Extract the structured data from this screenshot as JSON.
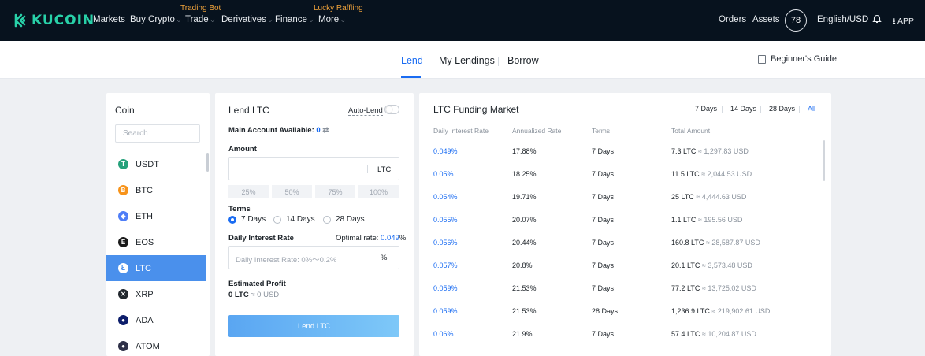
{
  "brand": {
    "name": "KUCOIN",
    "color": "#28d0a8"
  },
  "nav": {
    "items": [
      {
        "label": "Markets",
        "chevron": false
      },
      {
        "label": "Buy Crypto",
        "chevron": true
      },
      {
        "label": "Trade",
        "chevron": true,
        "tag": "Trading Bot"
      },
      {
        "label": "Derivatives",
        "chevron": true
      },
      {
        "label": "Finance",
        "chevron": true
      },
      {
        "label": "More",
        "chevron": true,
        "tag": "Lucky Raffling"
      }
    ],
    "orders": "Orders",
    "assets": "Assets",
    "avatar": "78",
    "language": "English/USD",
    "app": "APP"
  },
  "subnav": {
    "tabs": [
      {
        "label": "Lend",
        "active": true
      },
      {
        "label": "My Lendings",
        "active": false
      },
      {
        "label": "Borrow",
        "active": false
      }
    ],
    "guide": "Beginner's Guide"
  },
  "coin_panel": {
    "header": "Coin",
    "search_placeholder": "Search",
    "coins": [
      {
        "symbol": "USDT",
        "color": "#26a17b",
        "glyph": "T"
      },
      {
        "symbol": "BTC",
        "color": "#f7931a",
        "glyph": "B"
      },
      {
        "symbol": "ETH",
        "color": "#4f7ef7",
        "glyph": "◆"
      },
      {
        "symbol": "EOS",
        "color": "#1b1b1b",
        "glyph": "E"
      },
      {
        "symbol": "LTC",
        "color": "#ffffff",
        "glyph": "Ł",
        "active": true
      },
      {
        "symbol": "XRP",
        "color": "#23292f",
        "glyph": "✕"
      },
      {
        "symbol": "ADA",
        "color": "#0d1e6b",
        "glyph": "●"
      },
      {
        "symbol": "ATOM",
        "color": "#2e3148",
        "glyph": "●"
      }
    ]
  },
  "lend_panel": {
    "title": "Lend LTC",
    "autolend": "Auto-Lend",
    "account_label": "Main Account Available:",
    "account_value": "0",
    "amount_label": "Amount",
    "amount_unit": "LTC",
    "percents": [
      "25%",
      "50%",
      "75%",
      "100%"
    ],
    "terms_label": "Terms",
    "terms": [
      {
        "label": "7 Days",
        "selected": true
      },
      {
        "label": "14 Days",
        "selected": false
      },
      {
        "label": "28 Days",
        "selected": false
      }
    ],
    "rate_label": "Daily Interest Rate",
    "optimal_label": "Optimal rate:",
    "optimal_value": "0.049",
    "optimal_unit": "%",
    "rate_placeholder": "Daily Interest Rate: 0%～0.2%",
    "rate_unit": "%",
    "profit_label": "Estimated Profit",
    "profit_value": "0 LTC",
    "profit_usd": "≈ 0 USD",
    "button": "Lend LTC"
  },
  "market": {
    "title": "LTC Funding Market",
    "term_tabs": [
      {
        "label": "7 Days",
        "active": false
      },
      {
        "label": "14 Days",
        "active": false
      },
      {
        "label": "28 Days",
        "active": false
      },
      {
        "label": "All",
        "active": true
      }
    ],
    "columns": [
      "Daily Interest Rate",
      "Annualized Rate",
      "Terms",
      "Total Amount"
    ],
    "rows": [
      {
        "rate": "0.049%",
        "annual": "17.88%",
        "term": "7 Days",
        "amount": "7.3 LTC",
        "usd": "≈ 1,297.83 USD"
      },
      {
        "rate": "0.05%",
        "annual": "18.25%",
        "term": "7 Days",
        "amount": "11.5 LTC",
        "usd": "≈ 2,044.53 USD"
      },
      {
        "rate": "0.054%",
        "annual": "19.71%",
        "term": "7 Days",
        "amount": "25 LTC",
        "usd": "≈ 4,444.63 USD"
      },
      {
        "rate": "0.055%",
        "annual": "20.07%",
        "term": "7 Days",
        "amount": "1.1 LTC",
        "usd": "≈ 195.56 USD"
      },
      {
        "rate": "0.056%",
        "annual": "20.44%",
        "term": "7 Days",
        "amount": "160.8 LTC",
        "usd": "≈ 28,587.87 USD"
      },
      {
        "rate": "0.057%",
        "annual": "20.8%",
        "term": "7 Days",
        "amount": "20.1 LTC",
        "usd": "≈ 3,573.48 USD"
      },
      {
        "rate": "0.059%",
        "annual": "21.53%",
        "term": "7 Days",
        "amount": "77.2 LTC",
        "usd": "≈ 13,725.02 USD"
      },
      {
        "rate": "0.059%",
        "annual": "21.53%",
        "term": "28 Days",
        "amount": "1,236.9 LTC",
        "usd": "≈ 219,902.61 USD"
      },
      {
        "rate": "0.06%",
        "annual": "21.9%",
        "term": "7 Days",
        "amount": "57.4 LTC",
        "usd": "≈ 10,204.87 USD"
      }
    ]
  }
}
